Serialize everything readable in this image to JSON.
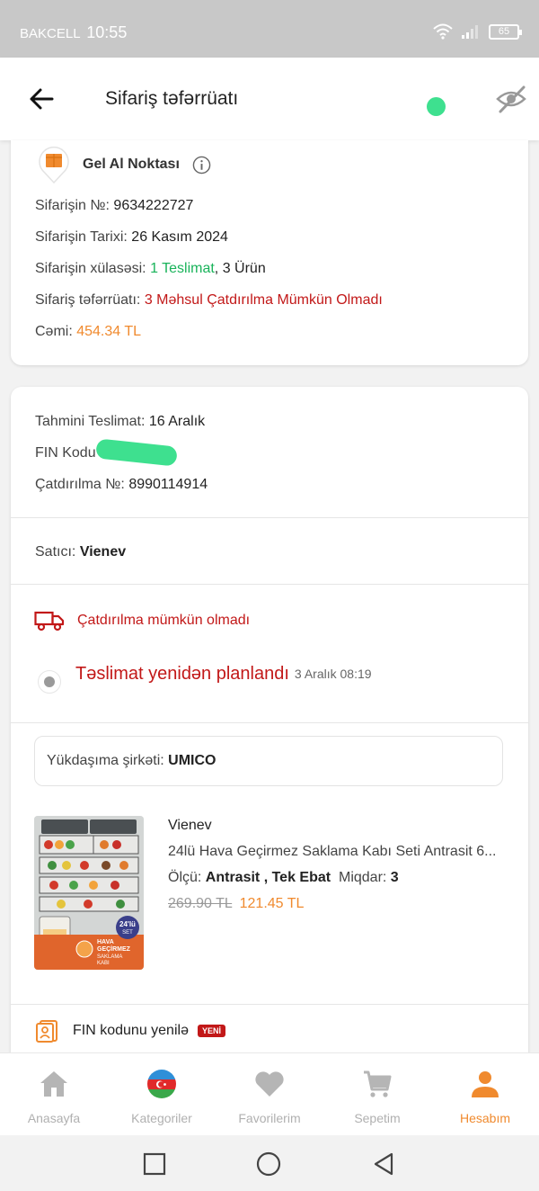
{
  "status_bar": {
    "carrier": "BAKCELL",
    "time": "10:55",
    "battery": "65"
  },
  "header": {
    "title": "Sifariş təfərrüatı"
  },
  "summary_card": {
    "pickup_label": "Gel Al Noktası",
    "order_no_label": "Sifarişin №:",
    "order_no": "9634222727",
    "order_date_label": "Sifarişin Tarixi:",
    "order_date": "26 Kasım 2024",
    "summary_label": "Sifarişin xülasəsi:",
    "summary_delivery": "1 Teslimat",
    "summary_items": ", 3 Ürün",
    "detail_label": "Sifariş təfərrüatı:",
    "detail_value": "3 Məhsul Çatdırılma Mümkün Olmadı",
    "total_label": "Cəmi:",
    "total_value": "454.34 TL"
  },
  "shipment": {
    "est_label": "Tahmini Teslimat:",
    "est_value": "16 Aralık",
    "fin_label": "FIN Kodu",
    "delivery_no_label": "Çatdırılma №:",
    "delivery_no": "8990114914",
    "seller_label": "Satıcı:",
    "seller": "Vienev",
    "status_text": "Çatdırılma mümkün olmadı",
    "timeline_title": "Təslimat yenidən planlandı",
    "timeline_time": "3 Aralık 08:19",
    "carrier_label": "Yükdaşıma şirkəti:",
    "carrier": "UMICO"
  },
  "product": {
    "seller": "Vienev",
    "name": "24lü Hava Geçirmez Saklama Kabı Seti Antrasit 6...",
    "size_label": "Ölçü:",
    "size": "Antrasit , Tek Ebat",
    "qty_label": "Miqdar:",
    "qty": "3",
    "old_price": "269.90 TL",
    "new_price": "121.45 TL",
    "image_text_count": "24'lü",
    "image_text_set": "SET",
    "image_text_line1": "HAVA",
    "image_text_line2": "GEÇİRMEZ",
    "image_text_line3": "SAKLAMA",
    "image_text_line4": "KABI"
  },
  "fin_refresh": {
    "label": "FIN kodunu yenilə",
    "badge": "YENİ"
  },
  "bottom_nav": [
    {
      "label": "Anasayfa",
      "icon": "home-icon"
    },
    {
      "label": "Kategoriler",
      "icon": "azerbaijan-flag-icon"
    },
    {
      "label": "Favorilerim",
      "icon": "heart-icon"
    },
    {
      "label": "Sepetim",
      "icon": "cart-icon"
    },
    {
      "label": "Hesabım",
      "icon": "user-icon",
      "active": true
    }
  ],
  "colors": {
    "accent": "#f08a2e",
    "error": "#c21818",
    "success": "#19b35a"
  }
}
